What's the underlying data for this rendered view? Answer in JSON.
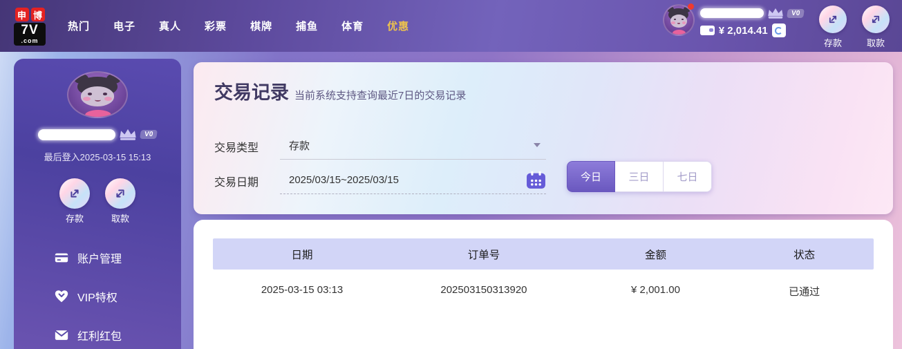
{
  "colors": {
    "nav_active": "#edc24d",
    "primary_purple": "#6a58bf",
    "table_header_bg": "#d2d5f7",
    "calendar_icon": "#655bd8",
    "sidebar_purple": "#5b4caa"
  },
  "topnav": {
    "logo": {
      "badge1": "申",
      "badge2": "博",
      "name": "7V",
      "tld": ".com"
    },
    "menu": [
      "热门",
      "电子",
      "真人",
      "彩票",
      "棋牌",
      "捕鱼",
      "体育",
      "优惠"
    ],
    "active_menu": "优惠",
    "user": {
      "vip_badge": "V0",
      "balance": "¥ 2,014.41"
    },
    "actions": [
      "存款",
      "取款"
    ]
  },
  "sidebar": {
    "vip_badge": "V0",
    "last_login": "最后登入2025-03-15 15:13",
    "actions": [
      "存款",
      "取款"
    ],
    "menu": [
      "账户管理",
      "VIP特权",
      "红利红包"
    ]
  },
  "main": {
    "title": "交易记录",
    "subtitle": "当前系统支持查询最近7日的交易记录",
    "filter": {
      "type_label": "交易类型",
      "type_value": "存款",
      "date_label": "交易日期",
      "date_value": "2025/03/15~2025/03/15",
      "range_buttons": [
        "今日",
        "三日",
        "七日"
      ],
      "active_range": "今日"
    },
    "table": {
      "headers": [
        "日期",
        "订单号",
        "金额",
        "状态"
      ],
      "rows": [
        {
          "date": "2025-03-15 03:13",
          "order_no": "202503150313920",
          "amount": "¥ 2,001.00",
          "status": "已通过"
        }
      ]
    }
  }
}
